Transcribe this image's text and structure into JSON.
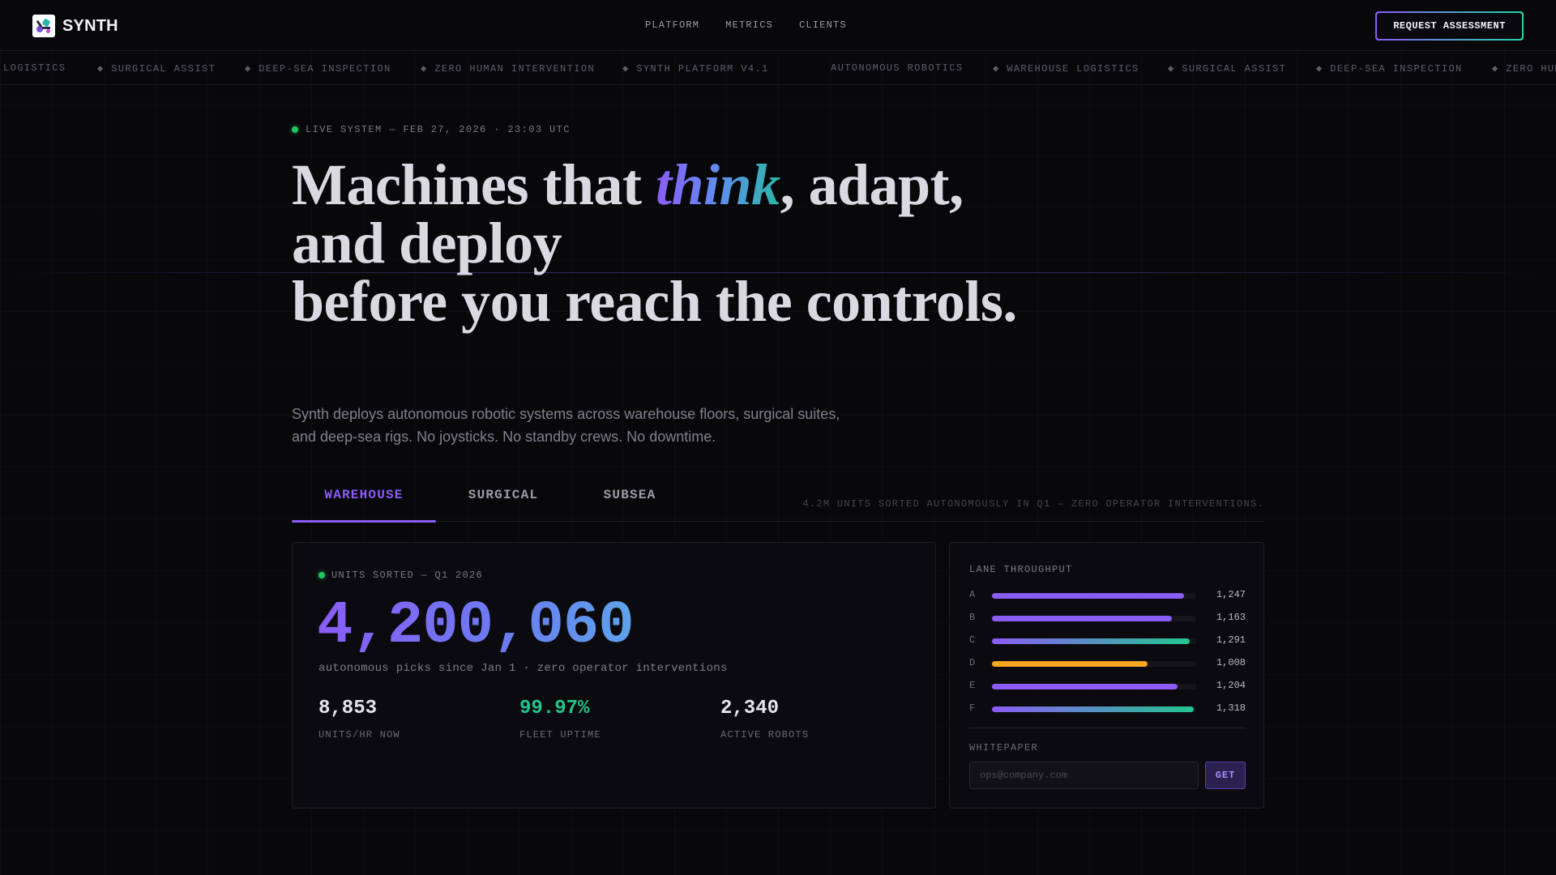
{
  "brand": {
    "name": "SYNTH"
  },
  "nav": {
    "items": [
      "PLATFORM",
      "METRICS",
      "CLIENTS"
    ],
    "cta_label": "REQUEST ASSESSMENT"
  },
  "ticker": {
    "items": [
      "LOGISTICS",
      "◆ SURGICAL ASSIST",
      "◆ DEEP-SEA INSPECTION",
      "◆ ZERO HUMAN INTERVENTION",
      "◆ SYNTH PLATFORM V4.1",
      "AUTONOMOUS ROBOTICS",
      "◆ WAREHOUSE LOGISTICS",
      "◆ SURGICAL ASSIST",
      "◆ DEEP-SEA INSPECTION",
      "◆ ZERO HUMAN INTERVENTION"
    ]
  },
  "hero": {
    "status": "LIVE SYSTEM — FEB 27, 2026 · 23:03 UTC",
    "headline_before": "Machines that ",
    "headline_emphasis": "think",
    "headline_after_1": ", adapt, and deploy",
    "headline_after_2": "before you reach the controls.",
    "subcopy": "Synth deploys autonomous robotic systems across warehouse floors, surgical suites, and deep-sea rigs. No joysticks. No standby crews. No downtime."
  },
  "tabs": {
    "items": [
      "WAREHOUSE",
      "SURGICAL",
      "SUBSEA"
    ],
    "active": "WAREHOUSE",
    "note": "4.2M UNITS SORTED AUTONOMOUSLY IN Q1 — ZERO OPERATOR INTERVENTIONS."
  },
  "main_card": {
    "label": "UNITS SORTED — Q1 2026",
    "big_number": "4,200,060",
    "caption": "autonomous picks since Jan 1 · zero operator interventions",
    "stats": [
      {
        "value": "8,853",
        "label": "UNITS/HR NOW"
      },
      {
        "value": "99.97%",
        "label": "FLEET UPTIME"
      },
      {
        "value": "2,340",
        "label": "ACTIVE ROBOTS"
      }
    ]
  },
  "side_card": {
    "title": "LANE THROUGHPUT",
    "lanes": [
      {
        "lane": "A",
        "value": "1,247",
        "level": 0.94,
        "color": "purple"
      },
      {
        "lane": "B",
        "value": "1,163",
        "level": 0.88,
        "color": "purple"
      },
      {
        "lane": "C",
        "value": "1,291",
        "level": 0.97,
        "color": "teal"
      },
      {
        "lane": "D",
        "value": "1,008",
        "level": 0.76,
        "color": "amber"
      },
      {
        "lane": "E",
        "value": "1,204",
        "level": 0.91,
        "color": "purple"
      },
      {
        "lane": "F",
        "value": "1,318",
        "level": 0.99,
        "color": "teal"
      }
    ],
    "whitepaper_title": "WHITEPAPER",
    "email_placeholder": "ops@company.com",
    "email_value": "",
    "get_label": "GET"
  },
  "colors": {
    "accent_purple": "#8b5cf6",
    "accent_teal": "#22c58e",
    "accent_amber": "#f5a623",
    "background": "#08080b"
  }
}
